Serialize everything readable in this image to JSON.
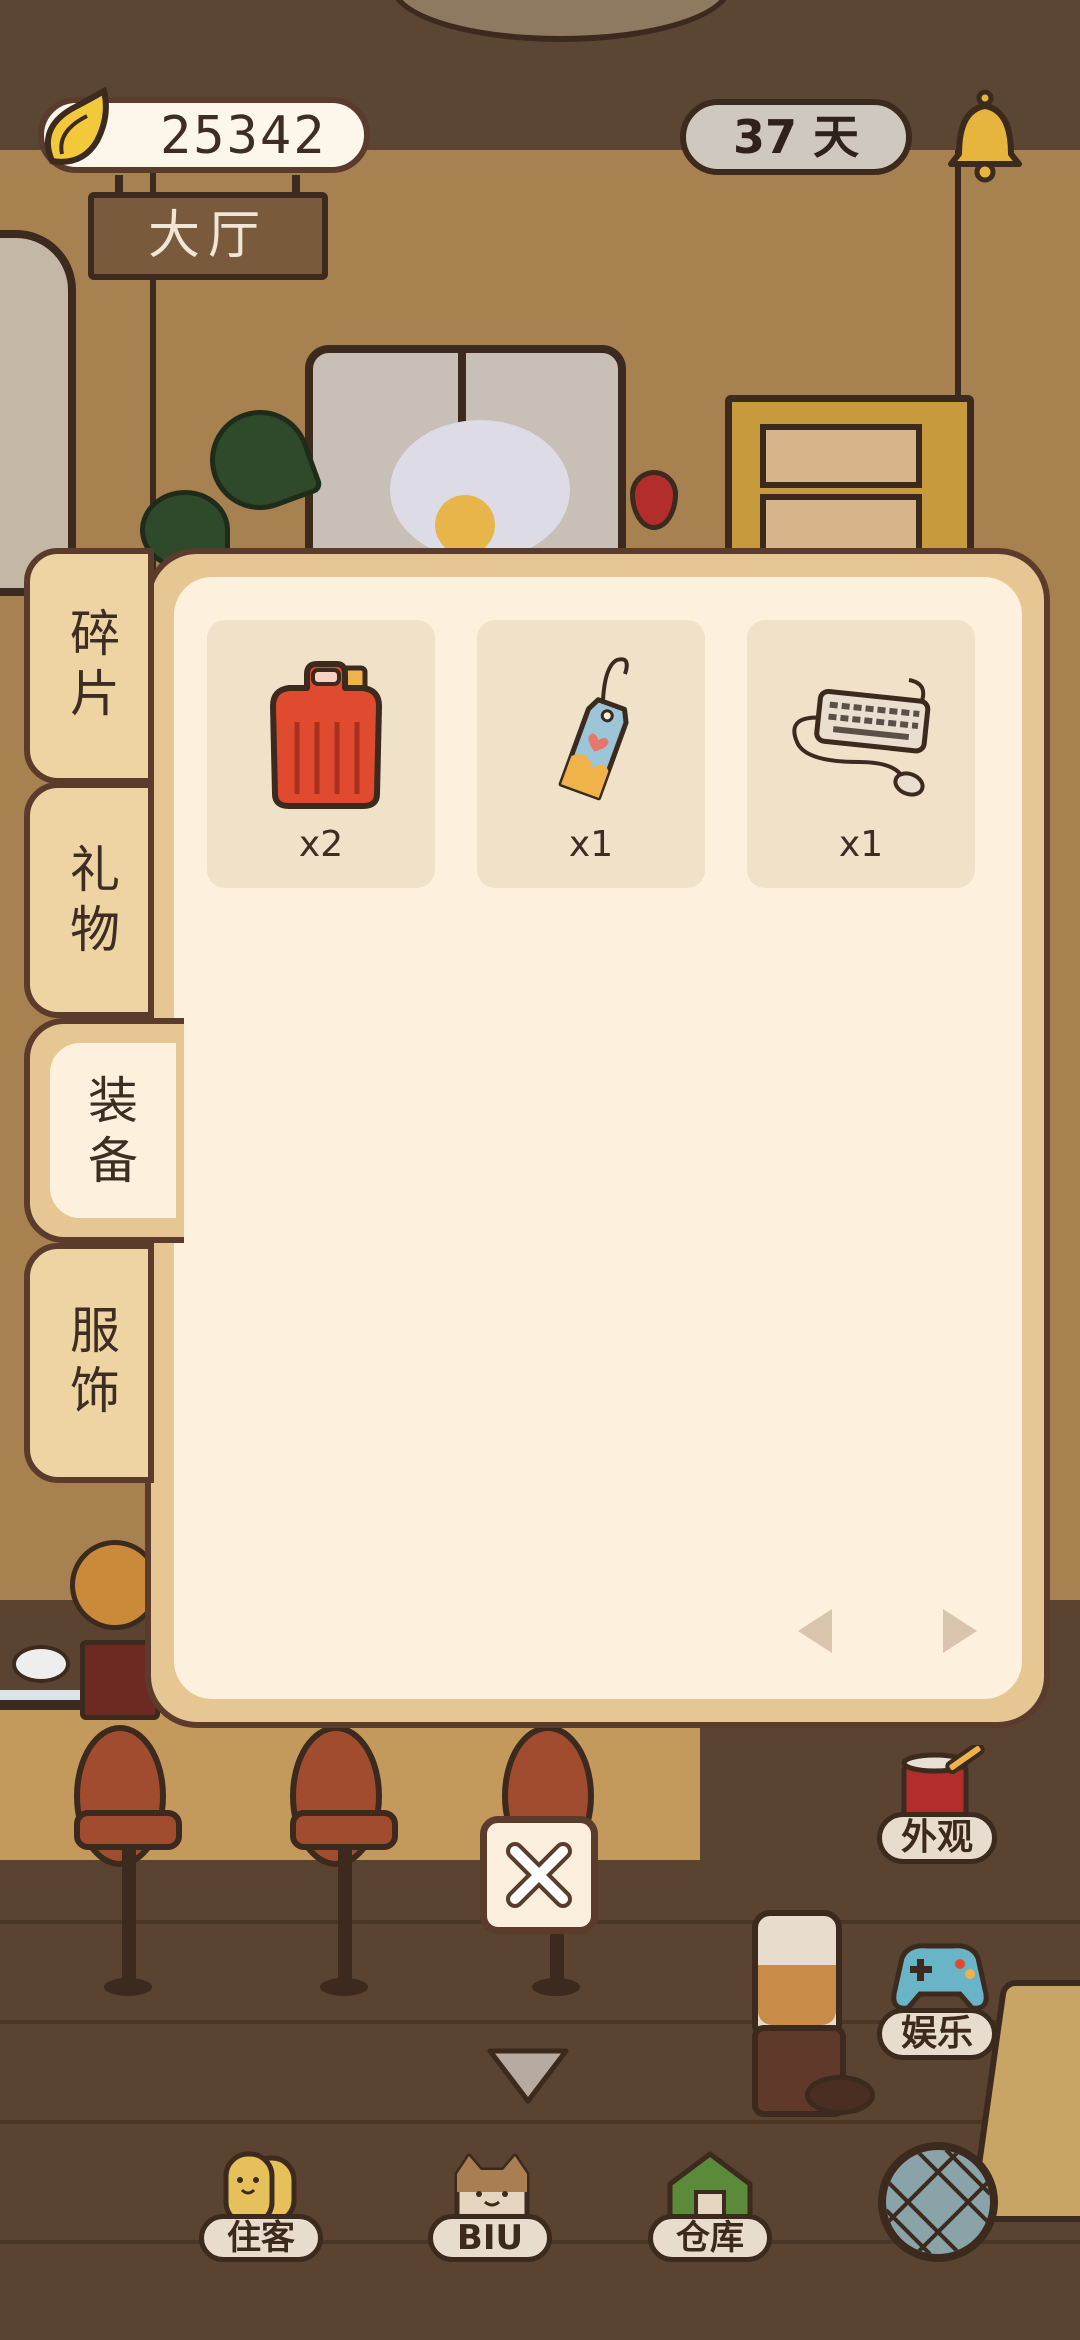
{
  "hud": {
    "coins": "25342",
    "days": "37 天",
    "room_name": "大厅"
  },
  "inventory": {
    "tabs": [
      {
        "label": "碎片",
        "active": false
      },
      {
        "label": "礼物",
        "active": false
      },
      {
        "label": "装备",
        "active": true
      },
      {
        "label": "服饰",
        "active": false
      }
    ],
    "items": [
      {
        "icon": "fuel-can-icon",
        "quantity": "x2"
      },
      {
        "icon": "price-tag-icon",
        "quantity": "x1"
      },
      {
        "icon": "keyboard-mouse-icon",
        "quantity": "x1"
      }
    ]
  },
  "side_buttons": {
    "appearance": "外观",
    "entertainment": "娱乐"
  },
  "bottom_nav": {
    "residents": "住客",
    "biu": "BIU",
    "storage": "仓库"
  },
  "colors": {
    "panel_fill": "#fdf1de",
    "panel_border": "#5b3c2c",
    "tab_fill": "#eed4a2",
    "slot_fill": "#f0e1c9",
    "text_dark": "#3e2d22"
  }
}
